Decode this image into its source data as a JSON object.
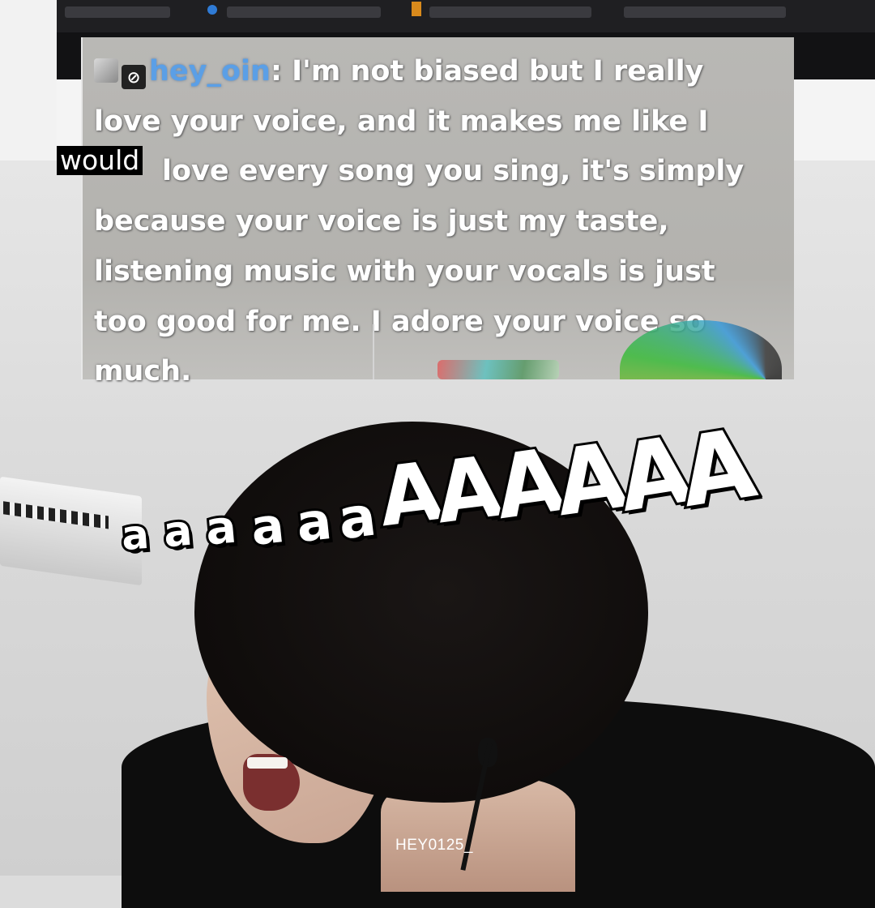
{
  "chat": {
    "username": "hey_oin",
    "separator": ": ",
    "line1": "I'm not biased but I really",
    "line2": "love your voice, and it makes me like I",
    "line3": "love every song you sing, it's simply",
    "line4": "because your voice is just my taste,",
    "line5": "listening music with your vocals is just",
    "line6": "too good for me. I adore your voice so",
    "line7": "much."
  },
  "caption": {
    "word": "would"
  },
  "scream": {
    "letters": [
      "a",
      "a",
      "a",
      "a",
      "a",
      "a",
      "A",
      "A",
      "A",
      "A",
      "A",
      "A"
    ]
  },
  "watermark": {
    "text": "HEY0125_"
  },
  "colors": {
    "username": "#5b9fe6",
    "chat_bg": "#b5b4b0",
    "caption_bg": "#000000"
  },
  "icons": {
    "badge_1": "robot-badge-icon",
    "badge_2": "eye-slash-badge-icon"
  }
}
